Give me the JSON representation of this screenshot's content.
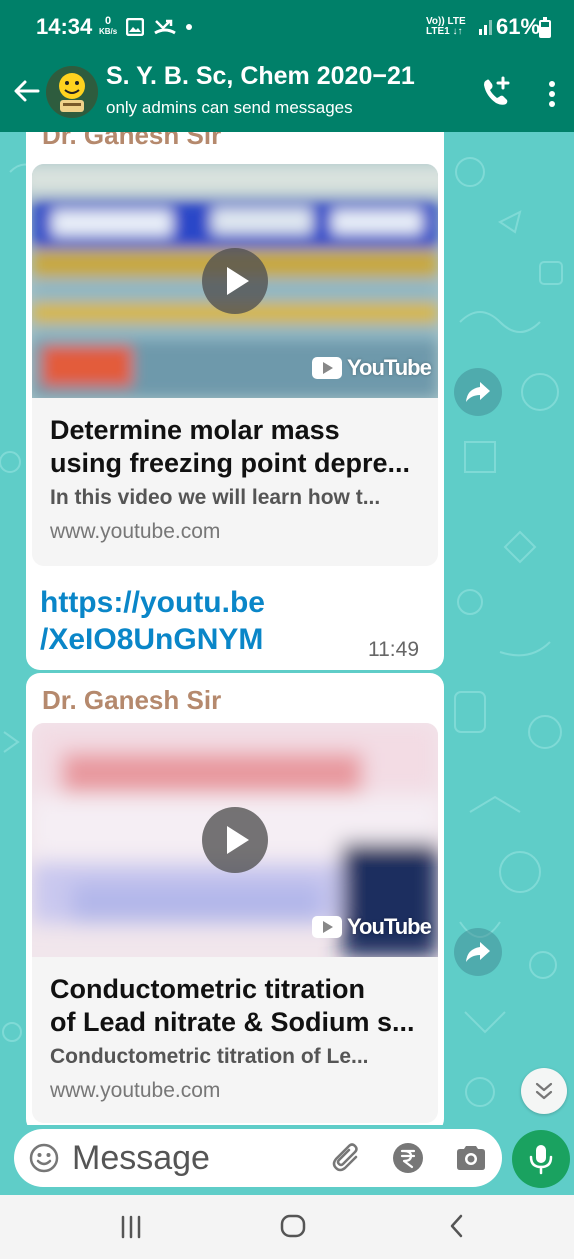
{
  "status_bar": {
    "time": "14:34",
    "net_speed_value": "0",
    "net_speed_unit": "KB/s",
    "network_label_top": "Vo)) LTE",
    "network_label_bottom": "LTE1 ↓↑",
    "battery_percent_text": "61%",
    "battery_level": 0.61
  },
  "header": {
    "title": "S. Y. B. Sc, Chem 2020−21",
    "subtitle": "only admins can send messages"
  },
  "messages": [
    {
      "sender": "Dr. Ganesh Sir",
      "preview": {
        "badge": "YouTube",
        "title_line1": "Determine molar mass",
        "title_line2": "using freezing point depre...",
        "description": "In this video we will learn how t...",
        "domain": "www.youtube.com"
      },
      "link_line1": "https://youtu.be",
      "link_line2": "/XeIO8UnGNYM",
      "time": "11:49"
    },
    {
      "sender": "Dr. Ganesh Sir",
      "preview": {
        "badge": "YouTube",
        "title_line1": "Conductometric titration",
        "title_line2": "of Lead nitrate & Sodium s...",
        "description": "Conductometric titration of Le...",
        "domain": "www.youtube.com"
      }
    }
  ],
  "composer": {
    "placeholder": "Message"
  },
  "colors": {
    "header_green": "#008069",
    "chat_background": "#5fcdc8",
    "sender_name": "#b5896d",
    "link": "#0a86c8",
    "mic_button": "#1aa260"
  },
  "icons": {
    "back": "arrow-left-icon",
    "call": "call-add-icon",
    "menu": "more-vertical-icon",
    "forward": "forward-icon",
    "scroll": "double-chevron-down-icon",
    "emoji": "emoji-icon",
    "attach": "paperclip-icon",
    "payment": "rupee-icon",
    "camera": "camera-icon",
    "mic": "mic-icon"
  }
}
